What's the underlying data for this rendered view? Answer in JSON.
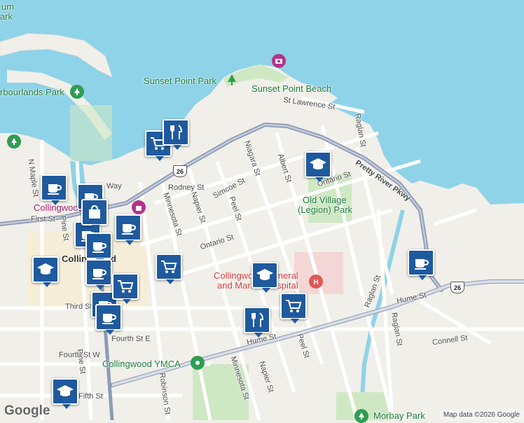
{
  "map": {
    "streets": [
      {
        "id": "first-st",
        "label": "First St"
      },
      {
        "id": "third-st",
        "label": "Third St"
      },
      {
        "id": "fourth-st-w",
        "label": "Fourth St W"
      },
      {
        "id": "fourth-st-e",
        "label": "Fourth St E"
      },
      {
        "id": "fifth-st",
        "label": "Fifth St"
      },
      {
        "id": "hume-st",
        "label": "Hume St"
      },
      {
        "id": "hume-st-2",
        "label": "Hume St"
      },
      {
        "id": "ontario-st",
        "label": "Ontario St"
      },
      {
        "id": "ontario-st-2",
        "label": "Ontario St"
      },
      {
        "id": "rodney-st",
        "label": "Rodney St"
      },
      {
        "id": "simcoe-st",
        "label": "Simcoe St"
      },
      {
        "id": "peel-st",
        "label": "Peel St"
      },
      {
        "id": "peel-st-2",
        "label": "Peel St"
      },
      {
        "id": "napier-st",
        "label": "Napier St"
      },
      {
        "id": "napier-st-2",
        "label": "Napier St"
      },
      {
        "id": "minnesota-st",
        "label": "Minnesota St"
      },
      {
        "id": "minnesota-st-2",
        "label": "Minnesota St"
      },
      {
        "id": "niagara-st",
        "label": "Niagara St"
      },
      {
        "id": "albert-st",
        "label": "Albert St"
      },
      {
        "id": "raglan-st",
        "label": "Raglan St"
      },
      {
        "id": "raglan-st-2",
        "label": "Raglan St"
      },
      {
        "id": "raglan-st-3",
        "label": "Raglan St"
      },
      {
        "id": "st-lawrence-st",
        "label": "St Lawrence St"
      },
      {
        "id": "pretty-river-pkwy",
        "label": "Pretty River Pkwy"
      },
      {
        "id": "connell-st",
        "label": "Connell St"
      },
      {
        "id": "n-maple-st",
        "label": "N Maple St"
      },
      {
        "id": "pine-st",
        "label": "Pine St"
      },
      {
        "id": "pine-st-2",
        "label": "Pine St"
      },
      {
        "id": "robinson-st",
        "label": "Robinson St"
      },
      {
        "id": "side-way",
        "label": "Way"
      }
    ],
    "places": {
      "sunset_point_park": "Sunset Point Park",
      "sunset_point_beach": "Sunset Point Beach",
      "harbourlands_park": "rbourlands Park",
      "old_village_park_line1": "Old Village",
      "old_village_park_line2": "(Legion) Park",
      "hospital_line1": "Collingwood General",
      "hospital_line2": "and Marine Hospital",
      "ymca": "Collingwood YMCA",
      "morbay_park": "Morbay Park",
      "collingwood_town": "Collingwood",
      "collingwood_label_2": "Collingwood",
      "top_left_partial_1": "um",
      "top_left_partial_2": "ark"
    },
    "route_shields": [
      "26",
      "26"
    ],
    "markers": [
      {
        "type": "cafe",
        "name": "cafe-marker"
      },
      {
        "type": "shopping",
        "name": "grocery-marker"
      },
      {
        "type": "restaurant",
        "name": "restaurant-marker"
      },
      {
        "type": "school",
        "name": "school-marker"
      }
    ]
  },
  "footer": {
    "logo": "Google",
    "attribution": "Map data ©2026 Google"
  },
  "colors": {
    "water": "#8fd3e8",
    "land": "#f1efe9",
    "park": "#cfe8c4",
    "road_major": "#8e9bb5",
    "road_minor": "#ffffff",
    "marker": "#1f5a9e",
    "hospital": "#e05757",
    "park_icon": "#2e9e52",
    "attraction": "#b5338a"
  }
}
